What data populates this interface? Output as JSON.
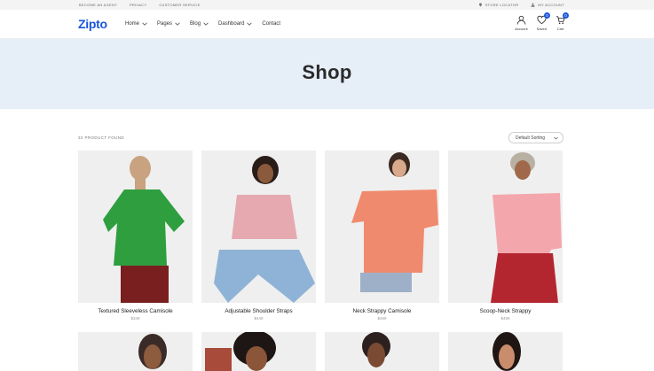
{
  "topbar": {
    "left_links": [
      "BECOME AN AGENT",
      "PRIVACY",
      "CUSTOMER SERVICE"
    ],
    "store_locator": "STORE LOCATOR",
    "my_account": "MY ACCOUNT"
  },
  "header": {
    "logo": "Zipto",
    "nav": [
      {
        "label": "Home",
        "dropdown": true
      },
      {
        "label": "Pages",
        "dropdown": true
      },
      {
        "label": "Blog",
        "dropdown": true
      },
      {
        "label": "Dashboard",
        "dropdown": true
      },
      {
        "label": "Contact",
        "dropdown": false
      }
    ],
    "icons": {
      "account_label": "Account",
      "saved_label": "Saved",
      "saved_count": "0",
      "cart_label": "Cart",
      "cart_count": "0"
    },
    "accent": "#1a56db"
  },
  "hero": {
    "title": "Shop",
    "background": "#e6eef8"
  },
  "listing": {
    "found_text": "32 PRODUCT FOUND",
    "sort_value": "Default Sorting"
  },
  "products": [
    {
      "name": "Textured Sleeveless Camisole",
      "price": "$349",
      "top_color": "#2f9e3f",
      "bottom_color": "#7a1f1f"
    },
    {
      "name": "Adjustable Shoulder Straps",
      "price": "$449",
      "top_color": "#e6a9b0",
      "bottom_color": "#8fb3d6"
    },
    {
      "name": "Neck Strappy Camisole",
      "price": "$469",
      "top_color": "#f08a6e",
      "bottom_color": "#9eb0c7"
    },
    {
      "name": "Scoop-Neck Strappy",
      "price": "$469",
      "top_color": "#f3a7ad",
      "bottom_color": "#b3262f"
    }
  ],
  "products_row2": [
    {
      "name": "",
      "top_color": "#3b2b28"
    },
    {
      "name": "",
      "top_color": "#a84b3a"
    },
    {
      "name": "",
      "top_color": "#2d211f"
    },
    {
      "name": "",
      "top_color": "#1f1614"
    }
  ]
}
